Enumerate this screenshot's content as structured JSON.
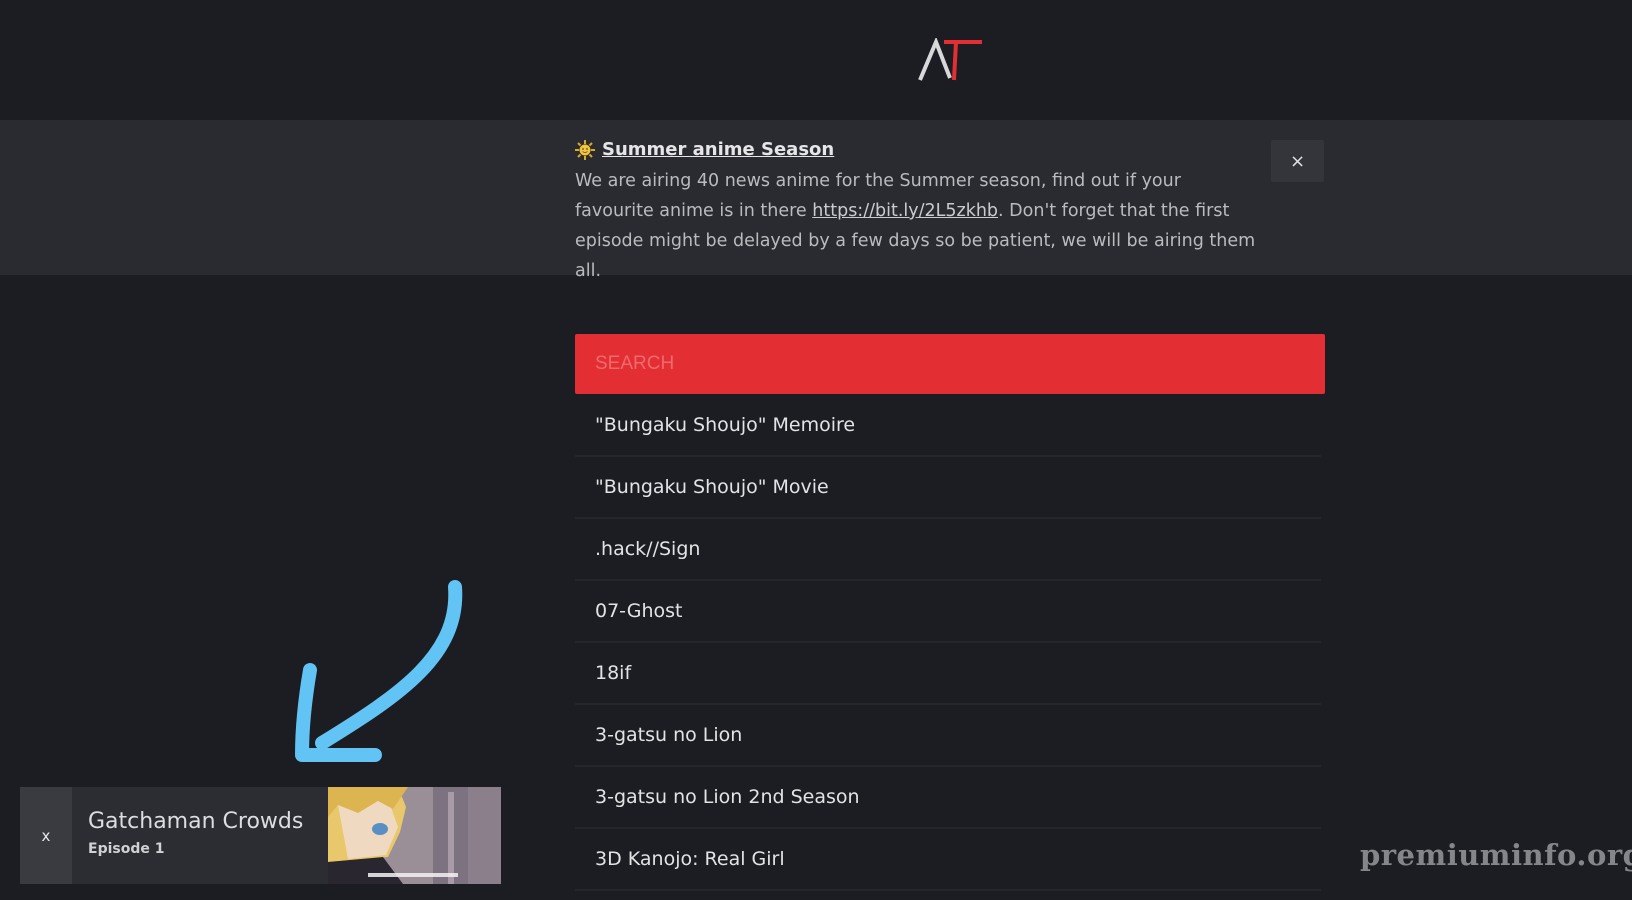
{
  "header": {
    "logo_icon": "at-logo-icon"
  },
  "announcement": {
    "icon": "sun-icon",
    "title": "Summer anime Season",
    "text_before_link": "We are airing 40 news anime for the Summer season, find out if your favourite anime is in there ",
    "link_text": "https://bit.ly/2L5zkhb",
    "text_after_link": ". Don't forget that the first episode might be delayed by a few days so be patient, we will be airing them all.",
    "close_label": "×"
  },
  "search": {
    "placeholder": "SEARCH"
  },
  "anime_list": [
    "\"Bungaku Shoujo\" Memoire",
    "\"Bungaku Shoujo\" Movie",
    ".hack//Sign",
    "07-Ghost",
    "18if",
    "3-gatsu no Lion",
    "3-gatsu no Lion 2nd Season",
    "3D Kanojo: Real Girl"
  ],
  "now_playing": {
    "close_label": "x",
    "title": "Gatchaman Crowds",
    "episode": "Episode 1",
    "thumbnail_icon": "anime-thumbnail"
  },
  "annotation": {
    "icon": "arrow-down-left-icon",
    "color": "#62c3f5"
  },
  "watermark": "premiuminfo.org",
  "colors": {
    "background": "#1b1d22",
    "banner": "#2a2b30",
    "accent": "#e32f33"
  }
}
